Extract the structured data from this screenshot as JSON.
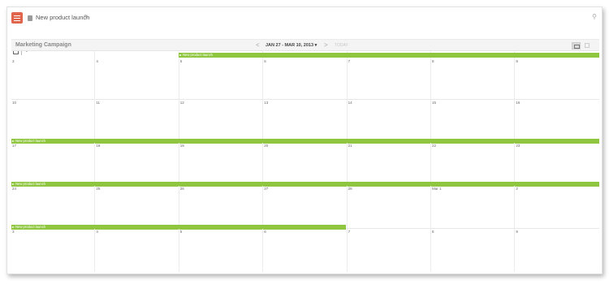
{
  "app": {
    "accent_color": "#e0654a",
    "menu_icon": "hamburger-icon",
    "doc_title": "New product launch",
    "doc_icon": "document-icon",
    "edit_icon": "pencil-icon",
    "pin_icon": "pin-icon"
  },
  "toolbar": {
    "calendar_icon": "calendar-icon",
    "add_label": "+"
  },
  "calendar": {
    "title": "Marketing Campaign",
    "prev": "<",
    "date_range": "JAN 27 - MAR 10, 2013",
    "range_caret": "▾",
    "next": ">",
    "today": "TODAY",
    "event_color": "#8ec63f",
    "weeks": [
      {
        "days": [
          "3",
          "4",
          "5",
          "6",
          "7",
          "8",
          "9"
        ]
      },
      {
        "days": [
          "10",
          "11",
          "12",
          "13",
          "14",
          "15",
          "16"
        ]
      },
      {
        "days": [
          "17",
          "18",
          "19",
          "20",
          "21",
          "22",
          "23"
        ]
      },
      {
        "days": [
          "24",
          "25",
          "26",
          "27",
          "28",
          "Mar 1",
          "2"
        ]
      },
      {
        "days": [
          "3",
          "4",
          "5",
          "6",
          "7",
          "8",
          "9"
        ]
      }
    ],
    "events": [
      {
        "label": "New product launch"
      },
      {
        "label": "New product launch"
      },
      {
        "label": "New product launch"
      },
      {
        "label": "New product launch"
      }
    ]
  }
}
